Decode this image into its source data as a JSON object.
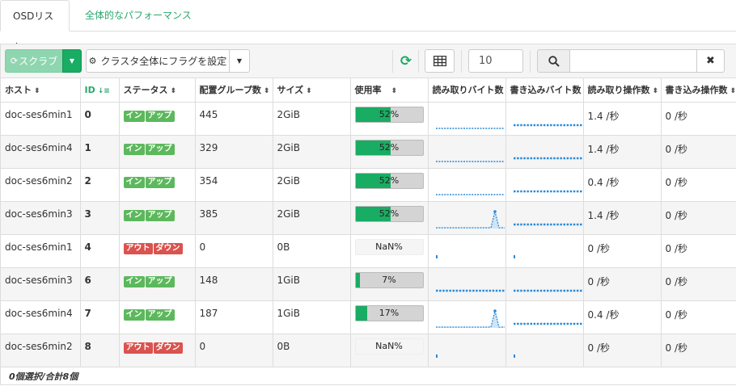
{
  "tabs": [
    {
      "label": "OSDリスト"
    },
    {
      "label": "全体的なパフォーマンス"
    }
  ],
  "toolbar": {
    "scrub_label": "スクラブ",
    "flags_label": "クラスタ全体にフラグを設定",
    "page_size": "10",
    "search_value": ""
  },
  "columns": {
    "host": "ホスト",
    "id": "ID",
    "status": "ステータス",
    "pgs": "配置グループ数",
    "size": "サイズ",
    "usage": "使用率",
    "read_bytes": "読み取りバイト数",
    "write_bytes": "書き込みバイト数",
    "read_ops": "読み取り操作数",
    "write_ops": "書き込み操作数"
  },
  "rows": [
    {
      "host": "doc-ses6min1",
      "id": "0",
      "status": [
        "イン",
        "アップ"
      ],
      "status_kind": "up",
      "pgs": "445",
      "size": "2GiB",
      "usage": 0.52,
      "usage_label": "52%",
      "read_spark": "flat",
      "write_spark": "dots",
      "read_ops": "1.4 /秒",
      "write_ops": "0 /秒"
    },
    {
      "host": "doc-ses6min4",
      "id": "1",
      "status": [
        "イン",
        "アップ"
      ],
      "status_kind": "up",
      "pgs": "329",
      "size": "2GiB",
      "usage": 0.52,
      "usage_label": "52%",
      "read_spark": "flat",
      "write_spark": "dots",
      "read_ops": "1.4 /秒",
      "write_ops": "0 /秒"
    },
    {
      "host": "doc-ses6min2",
      "id": "2",
      "status": [
        "イン",
        "アップ"
      ],
      "status_kind": "up",
      "pgs": "354",
      "size": "2GiB",
      "usage": 0.52,
      "usage_label": "52%",
      "read_spark": "flat",
      "write_spark": "dots",
      "read_ops": "0.4 /秒",
      "write_ops": "0 /秒"
    },
    {
      "host": "doc-ses6min3",
      "id": "3",
      "status": [
        "イン",
        "アップ"
      ],
      "status_kind": "up",
      "pgs": "385",
      "size": "2GiB",
      "usage": 0.52,
      "usage_label": "52%",
      "read_spark": "spike",
      "write_spark": "dots",
      "read_ops": "1.4 /秒",
      "write_ops": "0 /秒"
    },
    {
      "host": "doc-ses6min1",
      "id": "4",
      "status": [
        "アウト",
        "ダウン"
      ],
      "status_kind": "down",
      "pgs": "0",
      "size": "0B",
      "usage": null,
      "usage_label": "NaN%",
      "read_spark": "single",
      "write_spark": "single",
      "read_ops": "0 /秒",
      "write_ops": "0 /秒"
    },
    {
      "host": "doc-ses6min3",
      "id": "6",
      "status": [
        "イン",
        "アップ"
      ],
      "status_kind": "up",
      "pgs": "148",
      "size": "1GiB",
      "usage": 0.07,
      "usage_label": "7%",
      "read_spark": "dots",
      "write_spark": "dots",
      "read_ops": "0 /秒",
      "write_ops": "0 /秒"
    },
    {
      "host": "doc-ses6min4",
      "id": "7",
      "status": [
        "イン",
        "アップ"
      ],
      "status_kind": "up",
      "pgs": "187",
      "size": "1GiB",
      "usage": 0.17,
      "usage_label": "17%",
      "read_spark": "spike",
      "write_spark": "dots",
      "read_ops": "0.4 /秒",
      "write_ops": "0 /秒"
    },
    {
      "host": "doc-ses6min2",
      "id": "8",
      "status": [
        "アウト",
        "ダウン"
      ],
      "status_kind": "down",
      "pgs": "0",
      "size": "0B",
      "usage": null,
      "usage_label": "NaN%",
      "read_spark": "single",
      "write_spark": "single",
      "read_ops": "0 /秒",
      "write_ops": "0 /秒"
    }
  ],
  "footer": "0個選択/合計8個",
  "colors": {
    "accent": "#19ac63",
    "green_badge": "#5cb85c",
    "red_badge": "#d9534f",
    "spark": "#2b8ad8"
  }
}
